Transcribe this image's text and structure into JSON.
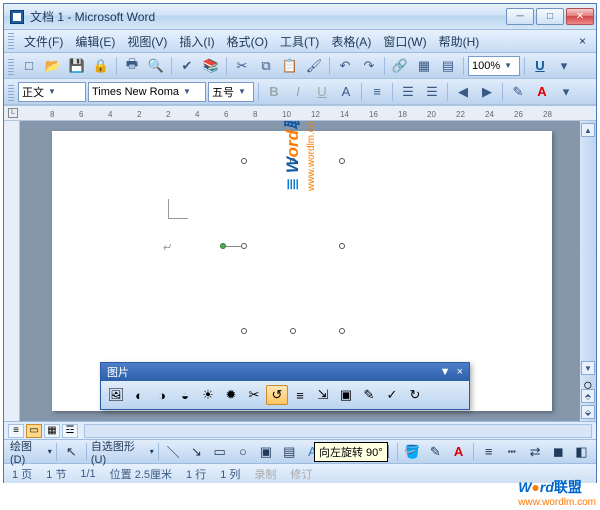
{
  "title": "文档 1 - Microsoft Word",
  "menu": {
    "file": "文件(F)",
    "edit": "编辑(E)",
    "view": "视图(V)",
    "insert": "插入(I)",
    "format": "格式(O)",
    "tools": "工具(T)",
    "table": "表格(A)",
    "window": "窗口(W)",
    "help": "帮助(H)"
  },
  "toolbar1": {
    "zoom": "100%"
  },
  "formatbar": {
    "style": "正文",
    "font": "Times New Roma",
    "size": "五号"
  },
  "ruler_marks": [
    "8",
    "6",
    "4",
    "2",
    "2",
    "4",
    "6",
    "8",
    "10",
    "12",
    "14",
    "16",
    "18",
    "20",
    "22",
    "24",
    "26",
    "28"
  ],
  "selected_image": {
    "brand_text": "Word联盟",
    "url_text": "www.wordlm.com",
    "brand_blue_part": "ord",
    "brand_w": "W"
  },
  "picture_toolbar": {
    "title": "图片"
  },
  "tooltip": "向左旋转 90°",
  "drawbar": {
    "label": "绘图(D)",
    "autoshapes": "自选图形(U)"
  },
  "statusbar": {
    "page": "1 页",
    "sec": "1 节",
    "pages": "1/1",
    "pos": "位置 2.5厘米",
    "line": "1 行",
    "col": "1 列",
    "rec": "录制",
    "rev": "修订"
  },
  "watermark": {
    "brand": "Word联盟",
    "url": "www.wordlm.com"
  }
}
